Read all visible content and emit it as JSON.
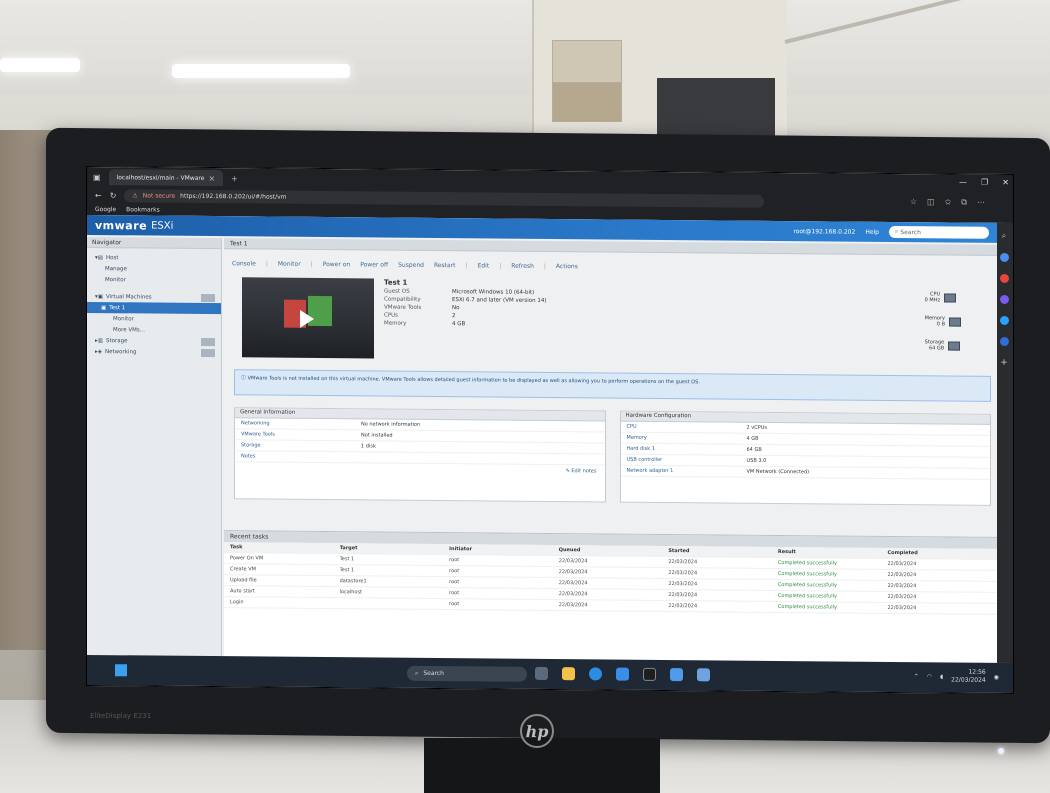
{
  "browser": {
    "tab_title": "localhost/esxi/main - VMware",
    "new_tab": "+",
    "url_warning": "Not secure",
    "url": "https://192.168.0.202/ui/#/host/vm",
    "bookmarks": [
      "Google",
      "Bookmarks"
    ]
  },
  "esxi": {
    "logo": "vmware",
    "logo_sub": "ESXi",
    "header_user": "root@192.168.0.202",
    "header_help": "Help",
    "search_placeholder": "Search",
    "navigator_title": "Navigator",
    "nav_items": [
      "Host",
      "Manage",
      "Monitor",
      "Virtual Machines",
      "Test 1",
      "Monitor",
      "More VMs...",
      "Storage",
      "Networking"
    ],
    "tab_title": "Test 1",
    "toolbar": [
      "Console",
      "Monitor",
      "Power on",
      "Power off",
      "Suspend",
      "Restart",
      "Edit",
      "Refresh",
      "Actions"
    ],
    "vm": {
      "name": "Test 1",
      "fields": [
        {
          "k": "Guest OS",
          "v": "Microsoft Windows 10 (64-bit)"
        },
        {
          "k": "Compatibility",
          "v": "ESXi 6.7 and later (VM version 14)"
        },
        {
          "k": "VMware Tools",
          "v": "No"
        },
        {
          "k": "CPUs",
          "v": "2"
        },
        {
          "k": "Memory",
          "v": "4 GB"
        }
      ],
      "stats": [
        {
          "label": "CPU",
          "value": "0 MHz"
        },
        {
          "label": "Memory",
          "value": "0 B"
        },
        {
          "label": "Storage",
          "value": "64 GB"
        }
      ]
    },
    "banner": "VMware Tools is not installed on this virtual machine. VMware Tools allows detailed guest information to be displayed as well as allowing you to perform operations on the guest OS.",
    "general_title": "General Information",
    "general_rows": [
      {
        "k": "Networking",
        "v": "No network information"
      },
      {
        "k": "VMware Tools",
        "v": "Not installed"
      },
      {
        "k": "Storage",
        "v": "1 disk"
      },
      {
        "k": "Notes",
        "v": ""
      }
    ],
    "general_action": "Edit notes",
    "hardware_title": "Hardware Configuration",
    "hardware_rows": [
      {
        "k": "CPU",
        "v": "2 vCPUs"
      },
      {
        "k": "Memory",
        "v": "4 GB"
      },
      {
        "k": "Hard disk 1",
        "v": "64 GB"
      },
      {
        "k": "USB controller",
        "v": "USB 3.0"
      },
      {
        "k": "Network adapter 1",
        "v": "VM Network (Connected)"
      }
    ],
    "tasks_title": "Recent tasks",
    "tasks_head": [
      "Task",
      "Target",
      "Initiator",
      "Queued",
      "Started",
      "Result",
      "Completed"
    ],
    "tasks": [
      [
        "Power On VM",
        "Test 1",
        "root",
        "22/03/2024",
        "22/03/2024",
        "Completed successfully",
        "22/03/2024"
      ],
      [
        "Create VM",
        "Test 1",
        "root",
        "22/03/2024",
        "22/03/2024",
        "Completed successfully",
        "22/03/2024"
      ],
      [
        "Upload file",
        "datastore1",
        "root",
        "22/03/2024",
        "22/03/2024",
        "Completed successfully",
        "22/03/2024"
      ],
      [
        "Auto start",
        "localhost",
        "root",
        "22/03/2024",
        "22/03/2024",
        "Completed successfully",
        "22/03/2024"
      ],
      [
        "Login",
        "",
        "root",
        "22/03/2024",
        "22/03/2024",
        "Completed successfully",
        "22/03/2024"
      ]
    ]
  },
  "taskbar": {
    "search": "Search",
    "time": "12:56",
    "date": "22/03/2024"
  },
  "monitor": {
    "brand": "EliteDisplay E231",
    "logo": "hp"
  }
}
